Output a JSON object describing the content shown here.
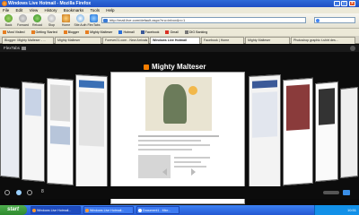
{
  "window": {
    "title": "Windows Live Hotmail - Mozilla Firefox",
    "minimize": "_",
    "maximize": "□",
    "close": "×"
  },
  "menu": [
    "File",
    "Edit",
    "View",
    "History",
    "Bookmarks",
    "Tools",
    "Help"
  ],
  "nav": {
    "buttons": [
      "Back",
      "Forward",
      "Reload",
      "Stop",
      "Home",
      "Site Auth",
      "FlexTabs"
    ],
    "url": "http://mail.live.com/default.aspx?rru=inbox&n=1"
  },
  "bookmarks": [
    "Most Visited",
    "Getting Started",
    "Blogger",
    "Mighty Malteser",
    "Hotmail",
    "Facebook",
    "Gmail",
    "DIG Banking"
  ],
  "tabs": [
    {
      "label": "Blogger: Mighty Malteser - ...",
      "active": false
    },
    {
      "label": "Mighty Malteser",
      "active": false
    },
    {
      "label": "Forever21.com - New Arrivals",
      "active": false
    },
    {
      "label": "Windows Live Hotmail",
      "active": true
    },
    {
      "label": "Facebook | Home",
      "active": false
    },
    {
      "label": "Mighty Malteser",
      "active": false
    },
    {
      "label": "Photoshop graphic t-shirt des...",
      "active": false
    }
  ],
  "flextabs": {
    "header": "FlexTabs",
    "card_title": "Mighty Malteser",
    "tab_count": "8"
  },
  "taskbar": {
    "start": "start",
    "items": [
      "Windows Live Hotmail...",
      "Windows Live Hotmail...",
      "Document1 - Micr..."
    ],
    "clock": "10:51"
  }
}
